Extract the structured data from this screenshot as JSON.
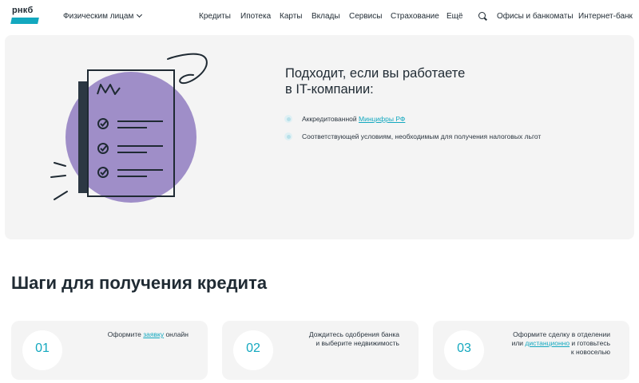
{
  "header": {
    "logo_text": "рнкб",
    "segment_label": "Физическим лицам",
    "nav": [
      {
        "label": "Кредиты"
      },
      {
        "label": "Ипотека"
      },
      {
        "label": "Карты"
      },
      {
        "label": "Вклады"
      },
      {
        "label": "Сервисы"
      },
      {
        "label": "Страхование"
      },
      {
        "label": "Ещё"
      }
    ],
    "offices_label": "Офисы и банкоматы",
    "internet_bank_label": "Интернет-банк"
  },
  "hero": {
    "title_line1": "Подходит, если вы работаете",
    "title_line2": "в IT-компании:",
    "bullets": [
      {
        "prefix": "Аккредитованной ",
        "link": "Минцифры РФ",
        "suffix": ""
      },
      {
        "prefix": "Соответствующей условиям, необходимым для получения налоговых льгот",
        "link": "",
        "suffix": ""
      }
    ],
    "illustration": {
      "circle_color": "#9f8ec8",
      "document_color": "#1f2a33",
      "icon": "checklist-document-icon"
    }
  },
  "steps_section": {
    "title": "Шаги для получения кредита",
    "steps": [
      {
        "number": "01",
        "line1_prefix": "Оформите ",
        "line1_link": "заявку",
        "line1_suffix": " онлайн",
        "line2": "",
        "line3": ""
      },
      {
        "number": "02",
        "line1_prefix": "Дождитесь одобрения банка",
        "line1_link": "",
        "line1_suffix": "",
        "line2": "и выберите недвижимость",
        "line3": ""
      },
      {
        "number": "03",
        "line1_prefix": "Оформите сделку в отделении",
        "line1_link": "",
        "line1_suffix": "",
        "line2_prefix": "или ",
        "line2_link": "дистанционно",
        "line2_suffix": " и готовьтесь",
        "line3": "к новоселью"
      }
    ]
  },
  "colors": {
    "accent": "#13a8bf",
    "text": "#1f2a33",
    "card_bg": "#f4f4f4",
    "illustration_purple": "#9f8ec8"
  }
}
